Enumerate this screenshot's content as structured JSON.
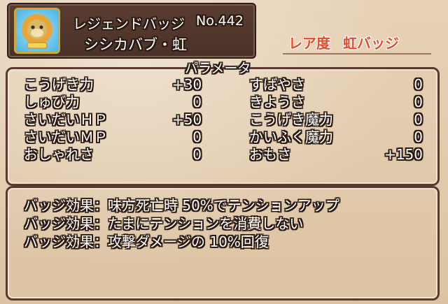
{
  "badge": {
    "name": "レジェンドバッジ",
    "number": "No.442",
    "title": "シシカバブ・虹",
    "icon": "lion-monster-emblem-icon"
  },
  "rarity": {
    "label": "レア度",
    "value": "虹バッジ"
  },
  "parameters": {
    "title": "パラメータ",
    "left": [
      {
        "label": "こうげき力",
        "value": "+30"
      },
      {
        "label": "しゅび力",
        "value": "0"
      },
      {
        "label": "さいだいＨＰ",
        "value": "+50"
      },
      {
        "label": "さいだいＭＰ",
        "value": "0"
      },
      {
        "label": "おしゃれさ",
        "value": "0"
      }
    ],
    "right": [
      {
        "label": "すばやさ",
        "value": "0"
      },
      {
        "label": "きようさ",
        "value": "0"
      },
      {
        "label": "こうげき魔力",
        "value": "0"
      },
      {
        "label": "かいふく魔力",
        "value": "0"
      },
      {
        "label": "おもさ",
        "value": "+150"
      }
    ]
  },
  "effects": [
    "バッジ効果：味方死亡時 50%でテンションアップ",
    "バッジ効果：たまにテンションを消費しない",
    "バッジ効果：攻撃ダメージの 10%回復"
  ],
  "colors": {
    "plate": "#4a3128",
    "border": "#5a3a2e",
    "rarity_text": "#e54b2a",
    "background": "#dcc3a3"
  }
}
